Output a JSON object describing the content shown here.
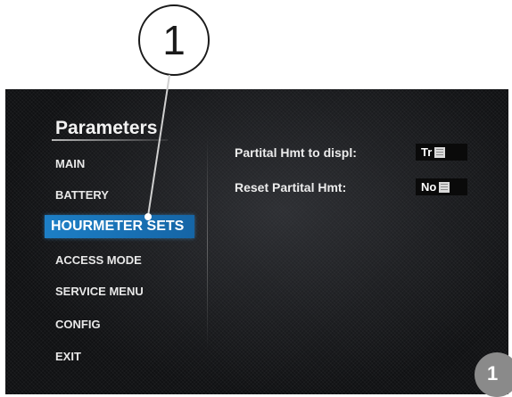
{
  "callout": {
    "number": "1"
  },
  "menu": {
    "title": "Parameters",
    "items": [
      {
        "label": "MAIN"
      },
      {
        "label": "BATTERY"
      },
      {
        "label": "HOURMETER SETS",
        "selected": true
      },
      {
        "label": "ACCESS MODE"
      },
      {
        "label": "SERVICE MENU"
      },
      {
        "label": "CONFIG"
      },
      {
        "label": "EXIT"
      }
    ]
  },
  "parameters": [
    {
      "label": "Partital Hmt to displ:",
      "value": "Tr",
      "icon": "list-icon"
    },
    {
      "label": "Reset Partital Hmt:",
      "value": "No",
      "icon": "list-icon"
    }
  ],
  "badge": {
    "number": "1"
  },
  "colors": {
    "selection": "#1d7fc6",
    "screen_background": "#101113",
    "badge": "#8a8a8a"
  }
}
